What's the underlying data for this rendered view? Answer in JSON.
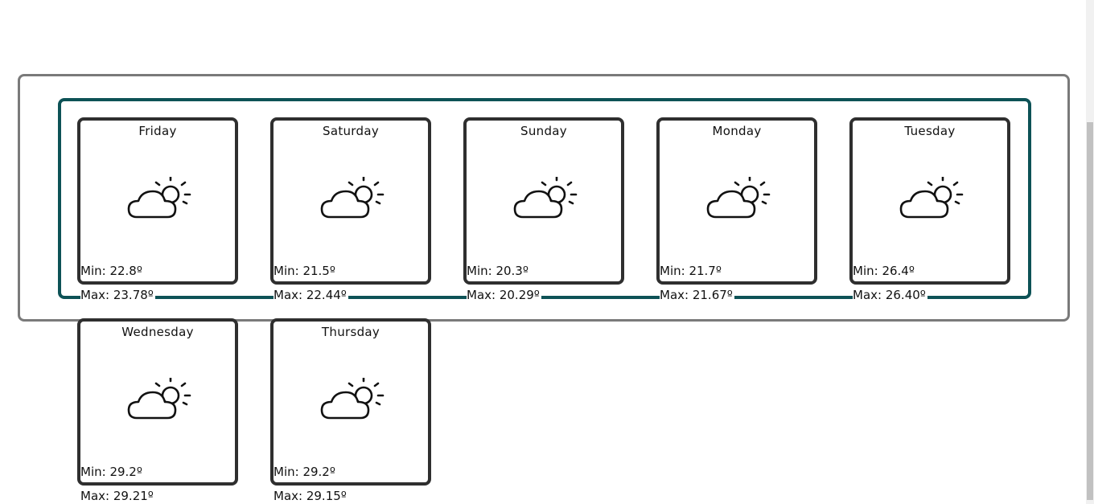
{
  "forecast": [
    {
      "day": "Friday",
      "min": "Min: 22.8º",
      "max": "Max: 23.78º",
      "icon": "partly-cloudy-icon"
    },
    {
      "day": "Saturday",
      "min": "Min: 21.5º",
      "max": "Max: 22.44º",
      "icon": "partly-cloudy-icon"
    },
    {
      "day": "Sunday",
      "min": "Min: 20.3º",
      "max": "Max: 20.29º",
      "icon": "partly-cloudy-icon"
    },
    {
      "day": "Monday",
      "min": "Min: 21.7º",
      "max": "Max: 21.67º",
      "icon": "partly-cloudy-icon"
    },
    {
      "day": "Tuesday",
      "min": "Min: 26.4º",
      "max": "Max: 26.40º",
      "icon": "partly-cloudy-icon"
    },
    {
      "day": "Wednesday",
      "min": "Min: 29.2º",
      "max": "Max: 29.21º",
      "icon": "partly-cloudy-icon"
    },
    {
      "day": "Thursday",
      "min": "Min: 29.2º",
      "max": "Max: 29.15º",
      "icon": "partly-cloudy-icon"
    }
  ],
  "colors": {
    "outer_border": "#7a7a7a",
    "inner_border": "#0d5256",
    "card_border": "#2f2f2f"
  }
}
